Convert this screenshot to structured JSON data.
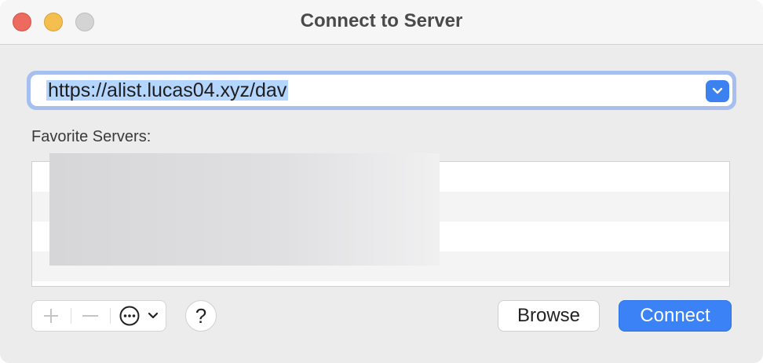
{
  "window": {
    "title": "Connect to Server"
  },
  "server_address": {
    "value": "https://alist.lucas04.xyz/dav",
    "dropdown_icon": "chevron-down-icon"
  },
  "favorites": {
    "label": "Favorite Servers:",
    "rows": [
      "",
      "",
      "",
      ""
    ]
  },
  "toolbar": {
    "add_icon": "plus-icon",
    "remove_icon": "minus-icon",
    "more_icon": "ellipsis-circle-icon",
    "help_label": "?"
  },
  "buttons": {
    "browse_label": "Browse",
    "connect_label": "Connect"
  },
  "colors": {
    "accent": "#3a82f6",
    "close": "#ed6a5e",
    "minimize": "#f5bf4f",
    "zoom_disabled": "#d4d4d4"
  }
}
